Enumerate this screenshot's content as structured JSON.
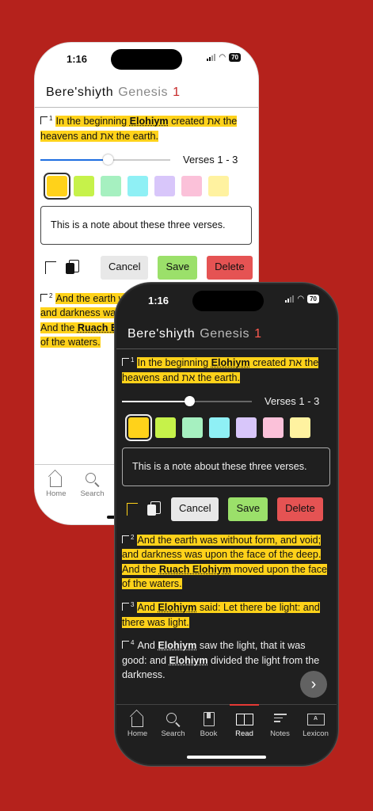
{
  "status": {
    "time": "1:16",
    "battery": "70"
  },
  "header": {
    "hebrew_book": "Bere'shiyth",
    "book": "Genesis",
    "chapter": "1"
  },
  "verses": {
    "v1": {
      "num": "1",
      "a": "In the beginning ",
      "name": "Elohiym",
      "b": " created את the heavens and את the earth."
    },
    "v2": {
      "num": "2",
      "a": "And the earth was without form, and void; and darkness was upon the face of the deep. And the ",
      "name": "Ruach Elohiym",
      "b": " moved upon the face of the waters."
    },
    "v3": {
      "num": "3",
      "a": "And ",
      "name": "Elohiym",
      "b": " said: Let there be light: and there was light."
    },
    "v4": {
      "num": "4",
      "a": "And ",
      "name": "Elohiym",
      "b": " saw the light, that it was good: and ",
      "name2": "Elohiym",
      "c": " divided the light from the darkness."
    }
  },
  "selection": {
    "range_label": "Verses 1 - 3",
    "slider_position_pct": 52
  },
  "swatches": [
    "#ffd21a",
    "#c6f24a",
    "#a6f0c0",
    "#8ff0f5",
    "#d8c6fa",
    "#fbc1d9",
    "#fff2a0"
  ],
  "note_text": "This is a note about these three verses.",
  "actions": {
    "cancel": "Cancel",
    "save": "Save",
    "delete": "Delete"
  },
  "tabs": {
    "home": "Home",
    "search": "Search",
    "book": "Book",
    "read": "Read",
    "notes": "Notes",
    "lexicon": "Lexicon"
  },
  "lexicon_icon_text": "A"
}
